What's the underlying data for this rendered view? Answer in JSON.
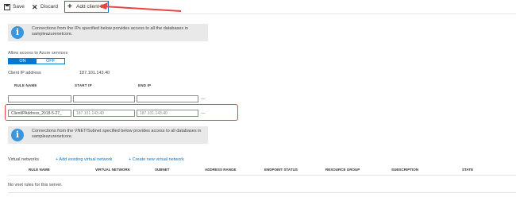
{
  "toolbar": {
    "save_label": "Save",
    "discard_label": "Discard",
    "add_client_ip_label": "Add client IP"
  },
  "info_top": {
    "icon": "info-icon",
    "text": "Connections from the IPs specified below provides access to all the databases in sampleazurenetcore."
  },
  "azure_services": {
    "label": "Allow access to Azure services",
    "on_label": "ON",
    "off_label": "OFF",
    "selected": "ON"
  },
  "client_ip": {
    "label": "Client IP address",
    "value": "187.101.143.40"
  },
  "firewall_table": {
    "headers": [
      "RULE NAME",
      "START IP",
      "END IP"
    ],
    "empty_row": {
      "rule_name": "",
      "start_ip": "",
      "end_ip": ""
    },
    "row": {
      "rule_name": "ClientIPAddress_2018-5-27_",
      "start_ip": "187.101.143.40",
      "end_ip": "187.101.143.40"
    },
    "more_label": "..."
  },
  "info_vnet": {
    "icon": "info-icon",
    "text": "Connections from the VNET/Subnet specified below provides access to all databases in sampleazurenetcore."
  },
  "virtual_networks": {
    "label": "Virtual networks",
    "add_existing_label": "+ Add existing virtual network",
    "create_new_label": "+ Create new virtual network",
    "headers": [
      "RULE NAME",
      "VIRTUAL NETWORK",
      "SUBNET",
      "ADDRESS RANGE",
      "ENDPOINT STATUS",
      "RESOURCE GROUP",
      "SUBSCRIPTION",
      "STATE"
    ],
    "empty_message": "No vnet rules for this server."
  },
  "colors": {
    "accent": "#0078d4",
    "annotation": "#e84545",
    "info_icon": "#3a96dd"
  }
}
